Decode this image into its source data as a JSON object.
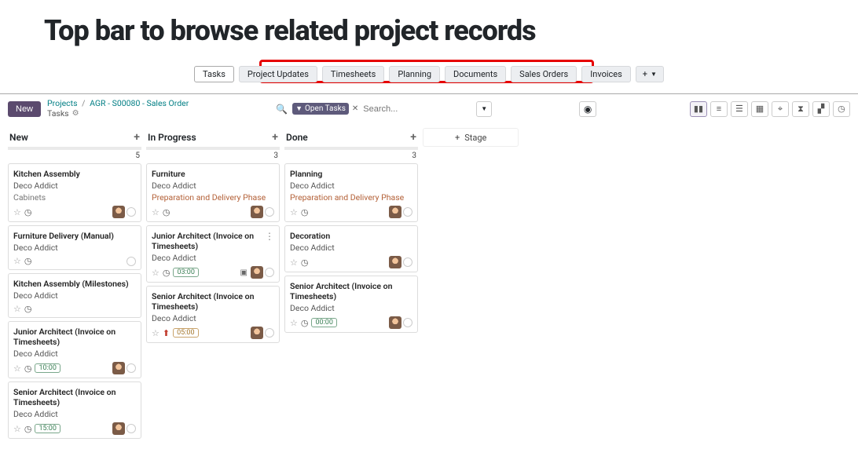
{
  "page_title": "Top bar to browse related project records",
  "tabs": {
    "tasks": "Tasks",
    "updates": "Project Updates",
    "timesheets": "Timesheets",
    "planning": "Planning",
    "documents": "Documents",
    "sales": "Sales Orders",
    "invoices": "Invoices",
    "add": "+"
  },
  "header": {
    "new_btn": "New",
    "bc_projects": "Projects",
    "bc_project": "AGR - S00080 - Sales Order",
    "bc_sub": "Tasks"
  },
  "search": {
    "chip": "Open Tasks",
    "placeholder": "Search..."
  },
  "columns": {
    "new": {
      "title": "New",
      "count": "5"
    },
    "progress": {
      "title": "In Progress",
      "count": "3"
    },
    "done": {
      "title": "Done",
      "count": "3"
    },
    "add_stage": "Stage"
  },
  "cards": {
    "new": [
      {
        "title": "Kitchen Assembly",
        "sub": "Deco Addict",
        "sub2": "Cabinets",
        "avatar": true
      },
      {
        "title": "Furniture Delivery (Manual)",
        "sub": "Deco Addict",
        "dot": true
      },
      {
        "title": "Kitchen Assembly (Milestones)",
        "sub": "Deco Addict"
      },
      {
        "title": "Junior Architect (Invoice on Timesheets)",
        "sub": "Deco Addict",
        "time": "10:00",
        "avatar": true
      },
      {
        "title": "Senior Architect (Invoice on Timesheets)",
        "sub": "Deco Addict",
        "time": "15:00",
        "avatar": true
      }
    ],
    "progress": [
      {
        "title": "Furniture",
        "sub": "Deco Addict",
        "phase": "Preparation and Delivery Phase",
        "avatar": true
      },
      {
        "title": "Junior Architect (Invoice on Timesheets)",
        "sub": "Deco Addict",
        "time": "03:00",
        "menu": true,
        "ai": true,
        "avatar": true
      },
      {
        "title": "Senior Architect (Invoice on Timesheets)",
        "sub": "Deco Addict",
        "time_orange": "05:00",
        "upload": true,
        "avatar": true
      }
    ],
    "done": [
      {
        "title": "Planning",
        "sub": "Deco Addict",
        "phase": "Preparation and Delivery Phase",
        "avatar": true
      },
      {
        "title": "Decoration",
        "sub": "Deco Addict",
        "avatar": true
      },
      {
        "title": "Senior Architect (Invoice on Timesheets)",
        "sub": "Deco Addict",
        "time": "00:00",
        "avatar": true
      }
    ]
  }
}
